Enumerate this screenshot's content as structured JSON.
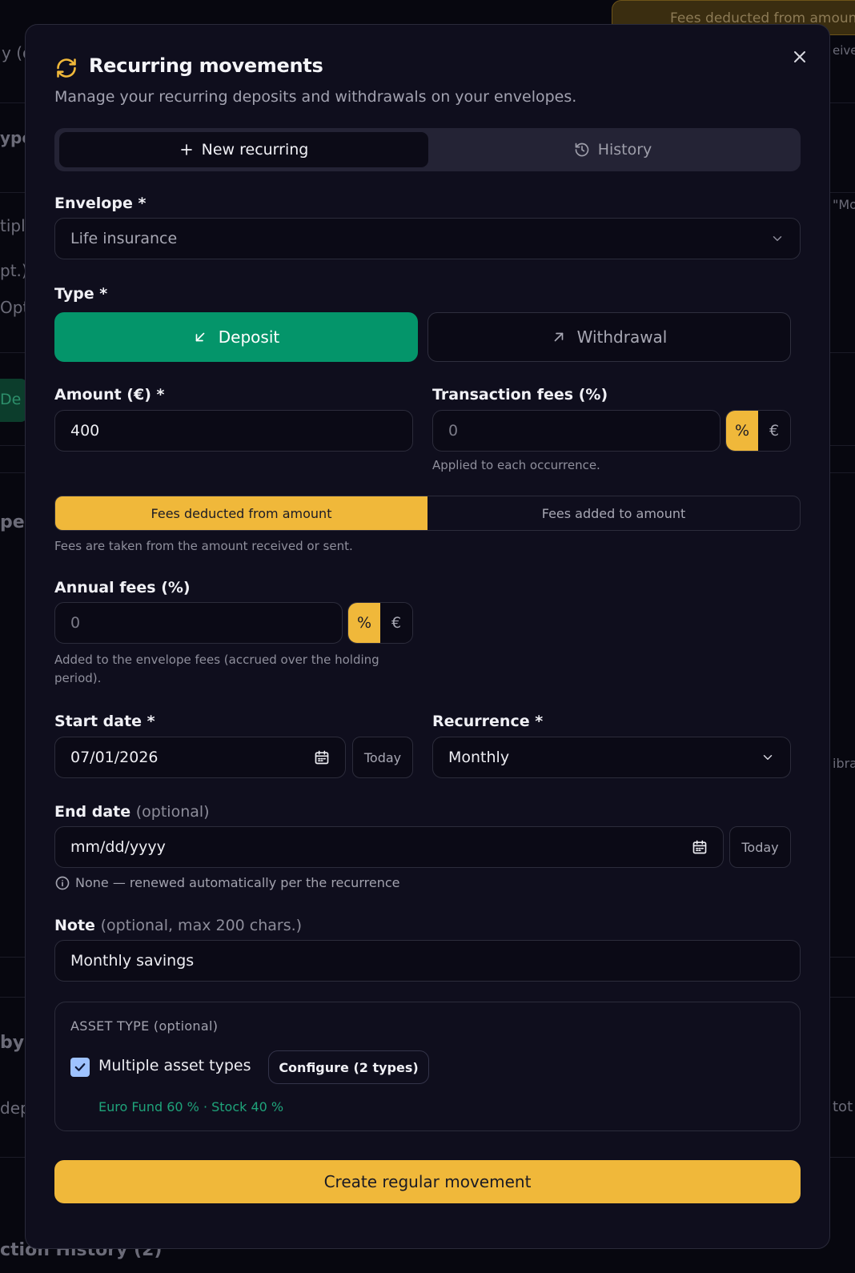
{
  "background": {
    "chip_text": "Fees deducted from amount",
    "fragments": [
      "y (o",
      "ype",
      "tiple",
      "pt.)",
      "Opti",
      "De",
      "pe",
      "by",
      "dep",
      "ction History (2)",
      "eive",
      "\"Mo",
      "ibra",
      "tot"
    ]
  },
  "modal": {
    "title": "Recurring movements",
    "subtitle": "Manage your recurring deposits and withdrawals on your envelopes.",
    "close_icon": "close-icon",
    "title_icon": "refresh-icon"
  },
  "tabs": [
    {
      "label": "New recurring",
      "icon": "plus-icon",
      "active": true
    },
    {
      "label": "History",
      "icon": "history-icon",
      "active": false
    }
  ],
  "envelope": {
    "label": "Envelope *",
    "value": "Life insurance"
  },
  "type": {
    "label": "Type *",
    "deposit": "Deposit",
    "withdrawal": "Withdrawal",
    "selected": "Deposit"
  },
  "amount": {
    "label": "Amount (€) *",
    "value": "400"
  },
  "transaction_fees": {
    "label": "Transaction fees (%)",
    "placeholder": "0",
    "unit_percent": "%",
    "unit_euro": "€",
    "selected_unit": "%",
    "help": "Applied to each occurrence."
  },
  "fee_mode": {
    "deducted": "Fees deducted from amount",
    "added": "Fees added to amount",
    "selected": "deducted",
    "help": "Fees are taken from the amount received or sent."
  },
  "annual_fees": {
    "label": "Annual fees (%)",
    "placeholder": "0",
    "unit_percent": "%",
    "unit_euro": "€",
    "selected_unit": "%",
    "help_line1": "Added to the envelope fees (accrued over the holding",
    "help_line2": "period)."
  },
  "start_date": {
    "label": "Start date *",
    "value": "07/01/2026",
    "today": "Today"
  },
  "recurrence": {
    "label": "Recurrence *",
    "value": "Monthly"
  },
  "end_date": {
    "label": "End date",
    "optional": "(optional)",
    "placeholder": "mm/dd/yyyy",
    "today": "Today",
    "help": "None — renewed automatically per the recurrence"
  },
  "note": {
    "label": "Note",
    "optional": "(optional, max 200 chars.)",
    "value": "Monthly savings"
  },
  "asset_type": {
    "heading": "ASSET TYPE",
    "optional": "(optional)",
    "checkbox_label": "Multiple asset types",
    "checked": true,
    "configure": "Configure (2 types)",
    "summary": "Euro Fund 60 % · Stock 40 %"
  },
  "submit": "Create regular movement",
  "colors": {
    "accent": "#f0b83a",
    "deposit": "#04956a",
    "summary": "#1fa37a"
  }
}
